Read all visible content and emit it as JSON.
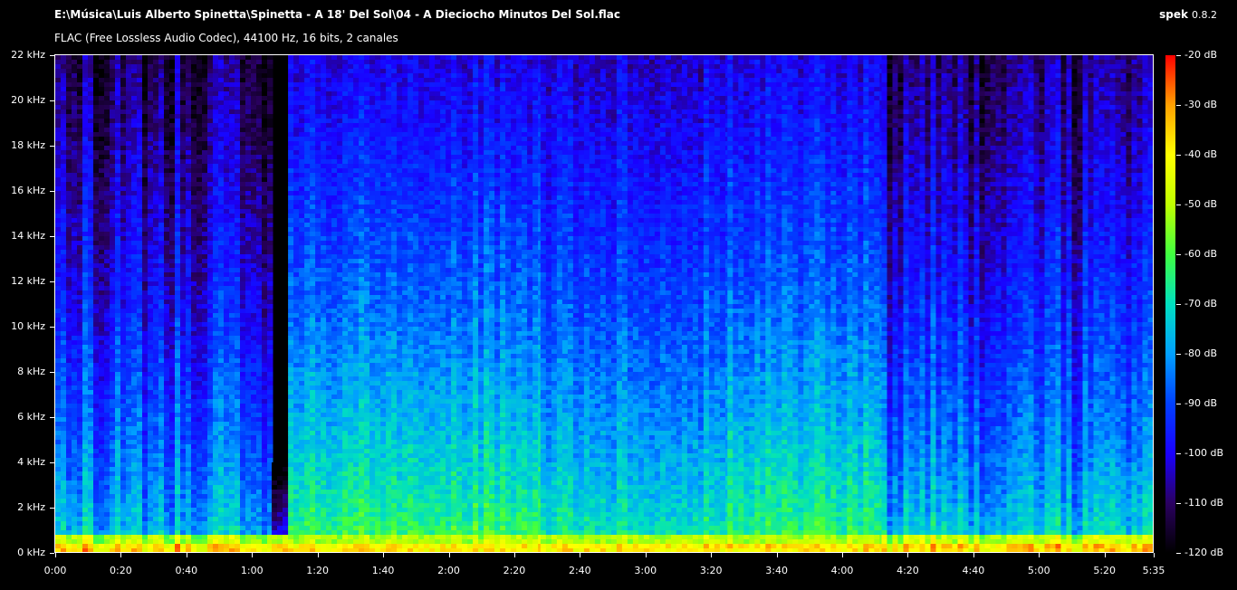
{
  "header": {
    "file_path": "E:\\Música\\Luis Alberto Spinetta\\Spinetta - A 18' Del Sol\\04 - A Dieciocho Minutos Del Sol.flac",
    "format_info": "FLAC (Free Lossless Audio Codec), 44100 Hz, 16 bits, 2 canales",
    "app_name": "spek",
    "app_version": "0.8.2"
  },
  "chart_data": {
    "type": "heatmap",
    "title": "E:\\Música\\Luis Alberto Spinetta\\Spinetta - A 18' Del Sol\\04 - A Dieciocho Minutos Del Sol.flac",
    "xlabel": "",
    "ylabel": "",
    "x_range_seconds": [
      0,
      335
    ],
    "y_range_khz": [
      0,
      22
    ],
    "x_ticks": [
      "0:00",
      "0:20",
      "0:40",
      "1:00",
      "1:20",
      "1:40",
      "2:00",
      "2:20",
      "2:40",
      "3:00",
      "3:20",
      "3:40",
      "4:00",
      "4:20",
      "4:40",
      "5:00",
      "5:20",
      "5:35"
    ],
    "x_tick_seconds": [
      0,
      20,
      40,
      60,
      80,
      100,
      120,
      140,
      160,
      180,
      200,
      220,
      240,
      260,
      280,
      300,
      320,
      335
    ],
    "y_ticks": [
      "0 kHz",
      "2 kHz",
      "4 kHz",
      "6 kHz",
      "8 kHz",
      "10 kHz",
      "12 kHz",
      "14 kHz",
      "16 kHz",
      "18 kHz",
      "20 kHz",
      "22 kHz"
    ],
    "y_tick_khz": [
      0,
      2,
      4,
      6,
      8,
      10,
      12,
      14,
      16,
      18,
      20,
      22
    ],
    "colorbar_ticks": [
      "-20 dB",
      "-30 dB",
      "-40 dB",
      "-50 dB",
      "-60 dB",
      "-70 dB",
      "-80 dB",
      "-90 dB",
      "-100 dB",
      "-110 dB",
      "-120 dB"
    ],
    "colorbar_db": [
      -20,
      -30,
      -40,
      -50,
      -60,
      -70,
      -80,
      -90,
      -100,
      -110,
      -120
    ],
    "db_range": [
      -120,
      -20
    ],
    "palette": [
      "#000000",
      "#2a0060",
      "#1a00ff",
      "#0040ff",
      "#00a0ff",
      "#00e0c0",
      "#40ff40",
      "#c0ff00",
      "#ffff00",
      "#ffa000",
      "#ff0000"
    ],
    "segments": [
      {
        "start": 0,
        "end": 66,
        "top_khz": 22,
        "base_db": -112,
        "low_db": -70,
        "texture": "sparse"
      },
      {
        "start": 66,
        "end": 71,
        "top_khz": 4,
        "base_db": -122,
        "low_db": -95,
        "texture": "fade"
      },
      {
        "start": 71,
        "end": 148,
        "top_khz": 22,
        "base_db": -100,
        "low_db": -55,
        "texture": "dense"
      },
      {
        "start": 148,
        "end": 205,
        "top_khz": 22,
        "base_db": -102,
        "low_db": -62,
        "texture": "dense"
      },
      {
        "start": 205,
        "end": 252,
        "top_khz": 22,
        "base_db": -100,
        "low_db": -57,
        "texture": "dense"
      },
      {
        "start": 252,
        "end": 335,
        "top_khz": 22,
        "base_db": -110,
        "low_db": -68,
        "texture": "sparse"
      }
    ]
  }
}
